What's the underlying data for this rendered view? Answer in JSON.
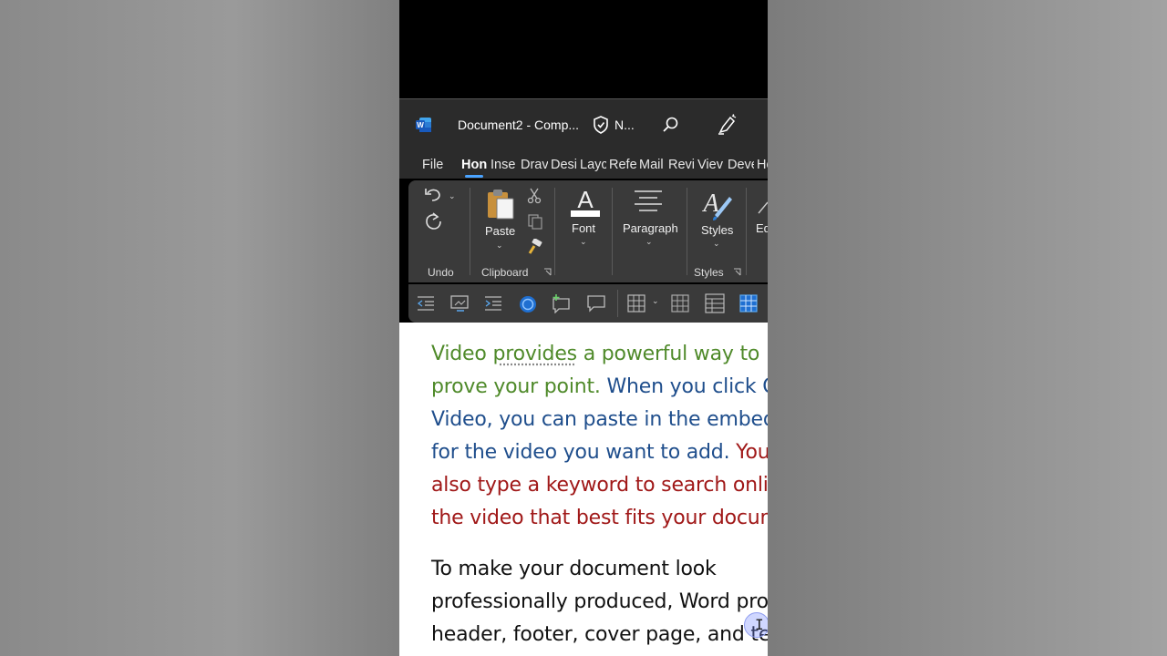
{
  "titlebar": {
    "doc_title": "Document2  -  Comp...",
    "sensitivity": "N...",
    "icons": [
      "word-logo-icon",
      "shield-icon",
      "search-icon",
      "pen-icon"
    ]
  },
  "tabs": {
    "items": [
      "File",
      "Hon",
      "Inse",
      "Drav",
      "Desi",
      "Layc",
      "Refe",
      "Mail",
      "Revi",
      "Viev",
      "Deve",
      "He"
    ],
    "active": "Hon"
  },
  "ribbon": {
    "undo_group": "Undo",
    "paste_label": "Paste",
    "clipboard_group": "Clipboard",
    "font_label": "Font",
    "paragraph_label": "Paragraph",
    "styles_label": "Styles",
    "styles_group": "Styles",
    "editing_label": "Ed"
  },
  "quick_toolbar": {
    "icons": [
      "decrease-indent-icon",
      "screen-share-icon",
      "increase-indent-icon",
      "circle-icon",
      "new-comment-icon",
      "comment-icon",
      "table-icon",
      "grid-icon",
      "table-layout-icon",
      "blue-table-icon"
    ]
  },
  "document": {
    "p1_l1_a": "Video ",
    "p1_l1_b": "provides",
    "p1_l1_c": " a powerful way to h",
    "p1_l2_a": "prove your point. ",
    "p1_l2_b": "When you click O",
    "p1_l3": "Video, you can paste in the embed",
    "p1_l4_a": "for the video you want to add. ",
    "p1_l4_b": "You",
    "p1_l5": "also type a keyword to search onlin",
    "p1_l6": "the video that best fits your docum",
    "p2_l1": "To make your document look",
    "p2_l2": "professionally produced, Word pro",
    "p2_l3": "header, footer, cover page, and tex"
  },
  "colors": {
    "green_text": "#4f8a2a",
    "blue_text": "#1f4e8c",
    "red_text": "#a01818",
    "active_tab_underline": "#4aa3ff",
    "ribbon_bg": "#3a3a3a",
    "titlebar_bg": "#2b2b2b"
  }
}
